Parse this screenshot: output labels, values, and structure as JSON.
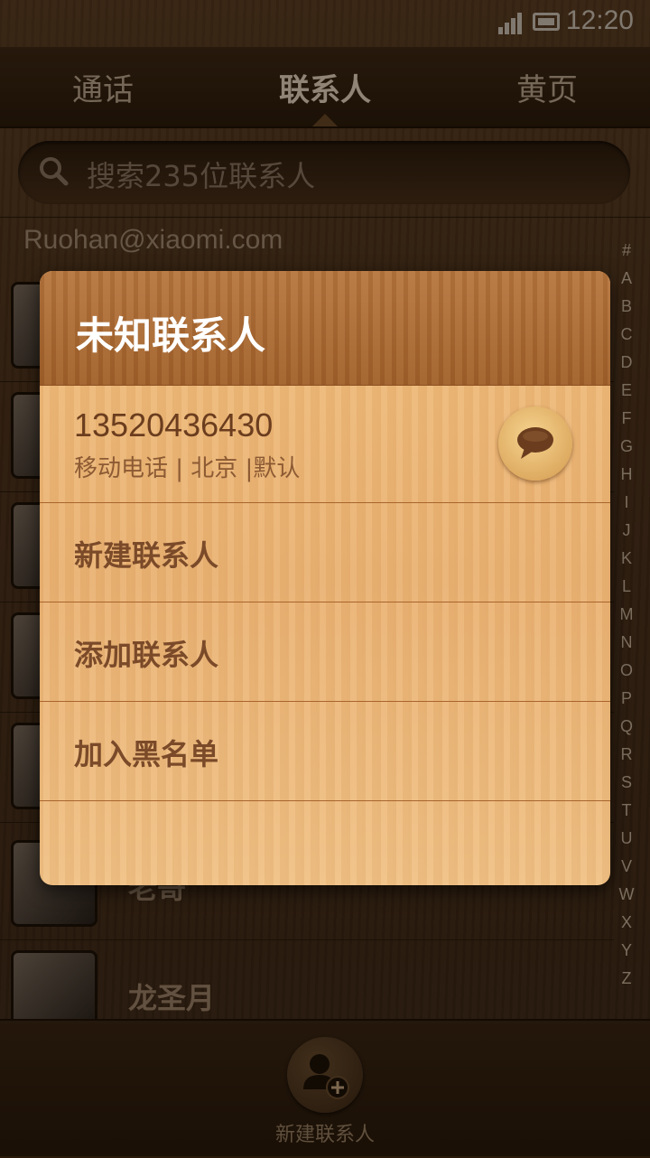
{
  "status_bar": {
    "time": "12:20"
  },
  "tabs": [
    {
      "label": "通话"
    },
    {
      "label": "联系人"
    },
    {
      "label": "黄页"
    }
  ],
  "search": {
    "placeholder": "搜索235位联系人"
  },
  "account": {
    "email": "Ruohan@xiaomi.com"
  },
  "contacts": [
    {
      "name": "老哥"
    },
    {
      "name": "龙圣月"
    }
  ],
  "index_letters": [
    "#",
    "A",
    "B",
    "C",
    "D",
    "E",
    "F",
    "G",
    "H",
    "I",
    "J",
    "K",
    "L",
    "M",
    "N",
    "O",
    "P",
    "Q",
    "R",
    "S",
    "T",
    "U",
    "V",
    "W",
    "X",
    "Y",
    "Z"
  ],
  "dialog": {
    "title": "未知联系人",
    "phone_number": "13520436430",
    "phone_meta": "移动电话 | 北京 |默认",
    "menu": [
      {
        "label": "新建联系人"
      },
      {
        "label": "添加联系人"
      },
      {
        "label": "加入黑名单"
      }
    ]
  },
  "bottom_bar": {
    "label": "新建联系人"
  },
  "colors": {
    "accent": "#e8b06e",
    "header": "#a8652e",
    "background": "#3a2614"
  }
}
